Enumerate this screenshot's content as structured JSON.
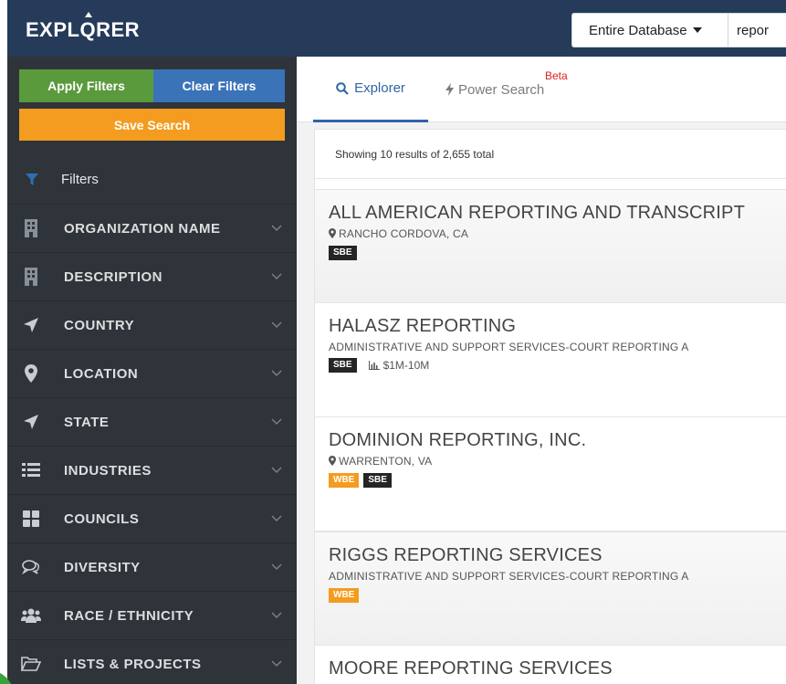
{
  "header": {
    "logo": "EXPLORER",
    "db_select": "Entire Database",
    "search_value": "repor"
  },
  "sidebar": {
    "apply_label": "Apply Filters",
    "clear_label": "Clear Filters",
    "save_label": "Save Search",
    "filters_label": "Filters",
    "items": [
      {
        "label": "ORGANIZATION NAME",
        "icon": "building-icon"
      },
      {
        "label": "DESCRIPTION",
        "icon": "building-icon"
      },
      {
        "label": "COUNTRY",
        "icon": "location-arrow-icon"
      },
      {
        "label": "LOCATION",
        "icon": "map-marker-icon"
      },
      {
        "label": "STATE",
        "icon": "location-arrow-icon"
      },
      {
        "label": "INDUSTRIES",
        "icon": "list-icon"
      },
      {
        "label": "COUNCILS",
        "icon": "grid-icon"
      },
      {
        "label": "DIVERSITY",
        "icon": "comments-icon"
      },
      {
        "label": "RACE / ETHNICITY",
        "icon": "users-icon"
      },
      {
        "label": "LISTS & PROJECTS",
        "icon": "folder-open-icon"
      }
    ]
  },
  "tabs": {
    "explorer": "Explorer",
    "power_search": "Power Search",
    "beta": "Beta"
  },
  "results": {
    "summary": "Showing 10 results of 2,655 total",
    "items": [
      {
        "name": "ALL AMERICAN REPORTING AND TRANSCRIPT",
        "location": "RANCHO CORDOVA, CA",
        "tags": [
          "SBE"
        ]
      },
      {
        "name": "HALASZ REPORTING",
        "description": "ADMINISTRATIVE AND SUPPORT SERVICES-COURT REPORTING A",
        "tags": [
          "SBE"
        ],
        "revenue": "$1M-10M"
      },
      {
        "name": "DOMINION REPORTING, INC.",
        "location": "WARRENTON, VA",
        "tags": [
          "WBE",
          "SBE"
        ]
      },
      {
        "name": "RIGGS REPORTING SERVICES",
        "description": "ADMINISTRATIVE AND SUPPORT SERVICES-COURT REPORTING A",
        "tags": [
          "WBE"
        ]
      },
      {
        "name": "MOORE REPORTING SERVICES"
      }
    ]
  },
  "colors": {
    "header_bg": "#253b59",
    "sidebar_bg": "#2f343b",
    "apply_green": "#5a9a3c",
    "clear_blue": "#3b73b9",
    "save_orange": "#f39c1f",
    "accent_blue": "#2f64a8",
    "beta_red": "#e02020"
  }
}
